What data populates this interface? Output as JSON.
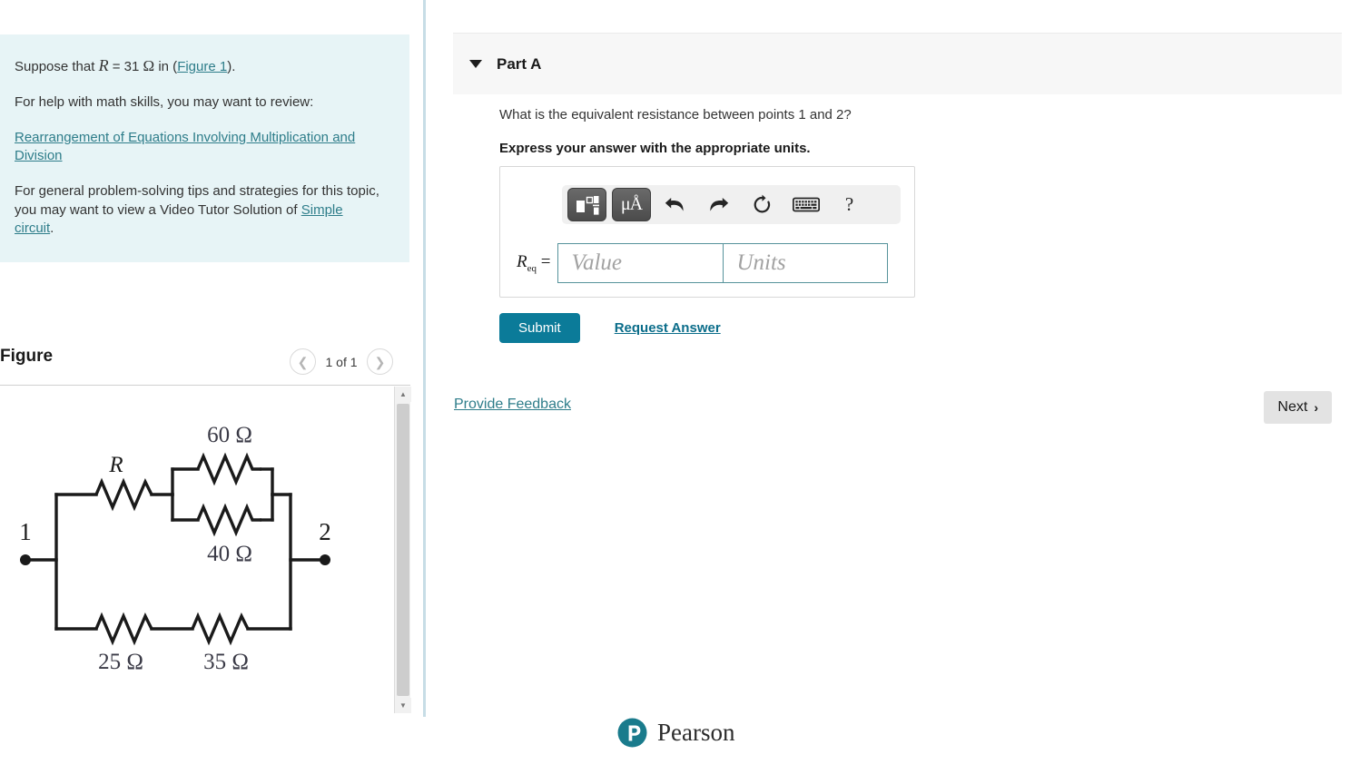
{
  "left": {
    "intro": {
      "line1_prefix": "Suppose that ",
      "line1_var": "R",
      "line1_mid": " = 31 ",
      "line1_omega": "Ω",
      "line1_in": " in (",
      "figure_link": "Figure 1",
      "line1_suffix": ").",
      "line2": "For help with math skills, you may want to review:",
      "review_link": "Rearrangement of Equations Involving Multiplication and Division",
      "line3_prefix": "For general problem-solving tips and strategies for this topic, you may want to view a Video Tutor Solution of ",
      "tutor_link": "Simple circuit",
      "line3_suffix": "."
    },
    "figure": {
      "title": "Figure",
      "count": "1 of 1",
      "prev_icon": "chevron-left-icon",
      "next_icon": "chevron-right-icon"
    }
  },
  "part": {
    "label": "Part A",
    "caret_icon": "caret-down-icon",
    "question": "What is the equivalent resistance between points 1 and 2?",
    "instruction": "Express your answer with the appropriate units."
  },
  "answer": {
    "toolbar": [
      {
        "name": "math-template-icon",
        "label": ""
      },
      {
        "name": "units-icon",
        "label": "μÅ"
      },
      {
        "name": "undo-icon",
        "label": ""
      },
      {
        "name": "redo-icon",
        "label": ""
      },
      {
        "name": "reset-icon",
        "label": ""
      },
      {
        "name": "keyboard-icon",
        "label": ""
      },
      {
        "name": "help-icon",
        "label": "?"
      }
    ],
    "symbol_main": "R",
    "symbol_sub": "eq",
    "equals": "=",
    "value_placeholder": "Value",
    "units_placeholder": "Units",
    "value": "",
    "units": ""
  },
  "actions": {
    "submit": "Submit",
    "request_answer": "Request Answer",
    "provide_feedback": "Provide Feedback",
    "next": "Next",
    "next_chevron": "›"
  },
  "footer": {
    "brand": "Pearson",
    "logo_icon": "pearson-logo-icon"
  },
  "colors": {
    "intro_bg": "#e7f4f6",
    "link_teal": "#2e7d8a",
    "submit_blue": "#0b7b99",
    "input_border": "#56939b",
    "part_header_bg": "#f7f7f7",
    "next_bg": "#e3e3e3",
    "divider": "#c7dde6"
  },
  "circuit": {
    "node_left_label": "1",
    "node_right_label": "2",
    "resistors": [
      {
        "name": "R-variable",
        "label": "R",
        "italic": true
      },
      {
        "name": "R-60",
        "label": "60 Ω",
        "italic": false
      },
      {
        "name": "R-40",
        "label": "40 Ω",
        "italic": false
      },
      {
        "name": "R-25",
        "label": "25 Ω",
        "italic": false
      },
      {
        "name": "R-35",
        "label": "35 Ω",
        "italic": false
      }
    ]
  }
}
